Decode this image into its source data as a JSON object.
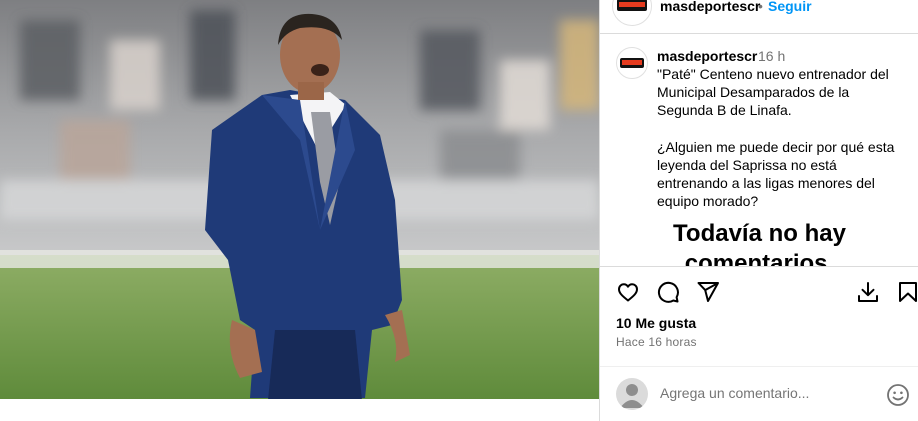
{
  "post": {
    "image_alt": "Hombre de traje azul en un estadio",
    "colors": {
      "suit": "#1f3a78",
      "grass": "#6f9a45",
      "link_blue": "#0095f6",
      "muted": "#737373",
      "border": "#dbdbdb"
    }
  },
  "header": {
    "username": "masdeportescr",
    "separator": "•",
    "follow_label": "Seguir"
  },
  "caption": {
    "username": "masdeportescr",
    "time": "16 h",
    "text": "\"Paté\" Centeno nuevo entrenador del Municipal Desamparados de la Segunda B de Linafa.\n\n¿Alguien me puede decir por qué esta leyenda del Saprissa no está entrenando a las ligas menores del equipo morado?"
  },
  "comments": {
    "empty_title": "Todavía no hay comentarios."
  },
  "actions": {
    "icons": [
      "heart-icon",
      "comment-icon",
      "share-icon",
      "download-icon",
      "bookmark-icon"
    ]
  },
  "stats": {
    "likes": "10 Me gusta",
    "time_ago": "Hace 16 horas"
  },
  "comment_input": {
    "placeholder": "Agrega un comentario..."
  }
}
